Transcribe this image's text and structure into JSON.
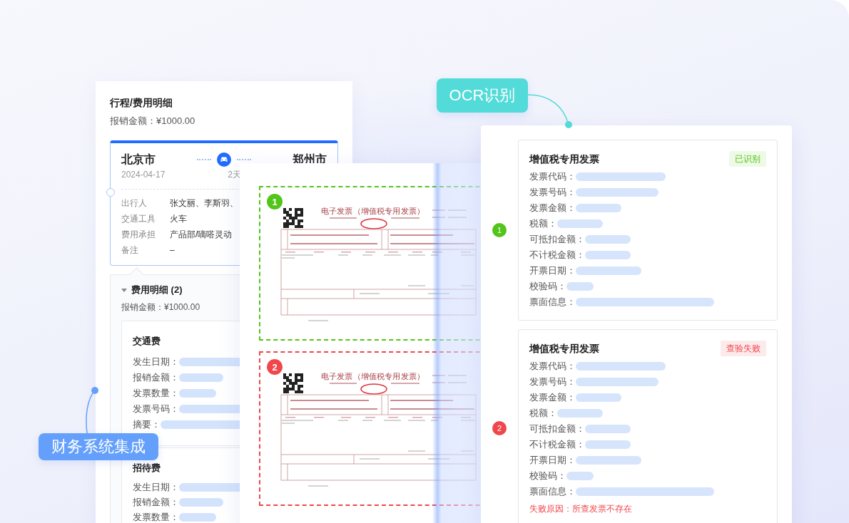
{
  "trip_panel": {
    "title": "行程/费用明细",
    "amount": "报销金额：¥1000.00",
    "trip": {
      "from": "北京市",
      "date": "2024-04-17",
      "duration": "2天",
      "to": "郑州市",
      "details": [
        {
          "label": "出行人",
          "value": "张文丽、李斯羽、"
        },
        {
          "label": "交通工具",
          "value": "火车"
        },
        {
          "label": "费用承担",
          "value": "产品部/嘀嗒灵动"
        },
        {
          "label": "备注",
          "value": "–"
        }
      ]
    },
    "expenses": {
      "title": "费用明细 (2)",
      "expanded": true,
      "amount": "报销金额：¥1000.00",
      "items": [
        {
          "title": "交通费",
          "fields": [
            "发生日期：",
            "报销金额：",
            "发票数量：",
            "发票号码：",
            "摘要："
          ]
        },
        {
          "title": "招待费",
          "fields": [
            "发生日期：",
            "报销金额：",
            "发票数量："
          ]
        }
      ]
    }
  },
  "invoice_viewer": {
    "invoices": [
      {
        "number": "1",
        "kind": "verified",
        "title": "电子发票（增值税专用发票）"
      },
      {
        "number": "2",
        "kind": "failed",
        "title": "电子发票（增值税专用发票）"
      }
    ]
  },
  "ocr_panel": {
    "results": [
      {
        "number": "1",
        "kind": "verified",
        "title": "增值税专用发票",
        "tag": "已识别",
        "fields": [
          "发票代码：",
          "发票号码：",
          "发票金额：",
          "税额：",
          "可抵扣金额：",
          "不计税金额：",
          "开票日期：",
          "校验码：",
          "票面信息："
        ]
      },
      {
        "number": "2",
        "kind": "failed",
        "title": "增值税专用发票",
        "tag": "查验失败",
        "fields": [
          "发票代码：",
          "发票号码：",
          "发票金额：",
          "税额：",
          "可抵扣金额：",
          "不计税金额：",
          "开票日期：",
          "校验码：",
          "票面信息："
        ],
        "failure_reason": "失败原因：所查发票不存在"
      }
    ]
  },
  "callouts": [
    {
      "label": "OCR识别",
      "kind": "ocr",
      "color": "#52dbd8"
    },
    {
      "label": "财务系统集成",
      "kind": "finance",
      "color": "#64a0fb"
    }
  ]
}
